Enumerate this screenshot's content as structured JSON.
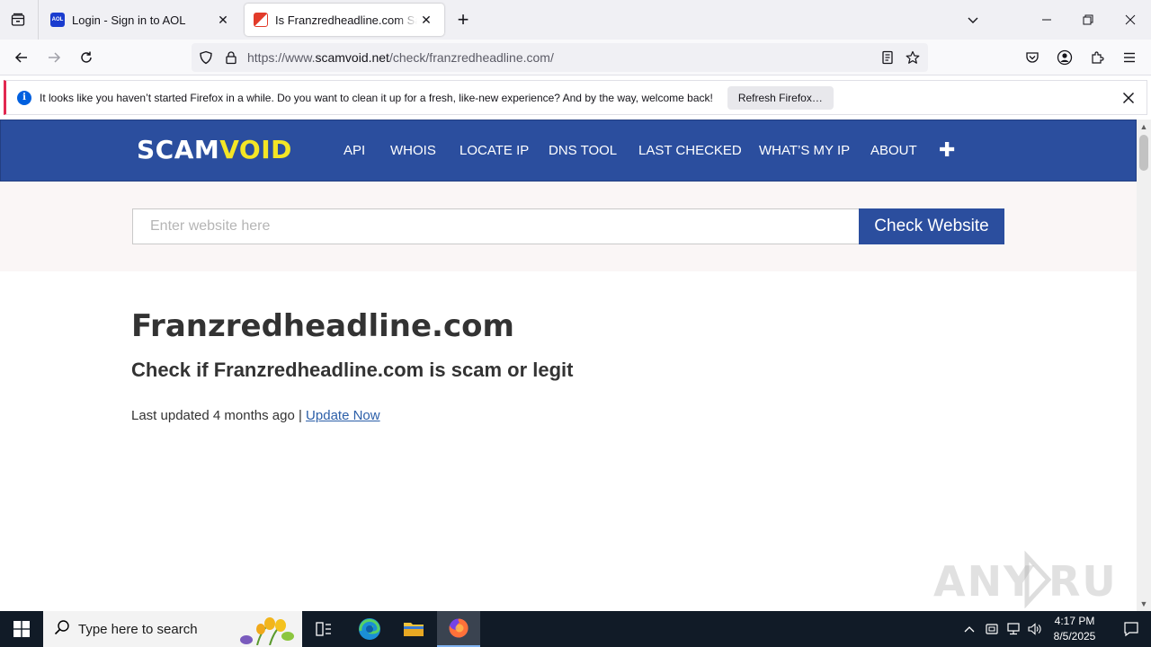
{
  "browser": {
    "tabs": [
      {
        "title": "Login - Sign in to AOL",
        "favicon": "aol-icon",
        "active": false
      },
      {
        "title": "Is Franzredheadline.com Safe or a Scam?",
        "favicon": "scamvoid-icon",
        "active": true
      }
    ],
    "url": {
      "prefix": "https://www.",
      "host": "scamvoid.net",
      "path": "/check/franzredheadline.com/"
    },
    "notification": {
      "message": "It looks like you haven’t started Firefox in a while. Do you want to clean it up for a fresh, like-new experience? And by the way, welcome back!",
      "button": "Refresh Firefox…"
    }
  },
  "site": {
    "logo": {
      "part1": "SCAM",
      "part2": "VOID"
    },
    "menu": [
      "API",
      "WHOIS",
      "LOCATE IP",
      "DNS TOOL",
      "LAST CHECKED",
      "WHAT’S MY IP",
      "ABOUT"
    ],
    "menu_more": "✚",
    "search": {
      "placeholder": "Enter website here",
      "button": "Check Website"
    },
    "domain_title": "Franzredheadline.com",
    "subtitle": "Check if Franzredheadline.com is scam or legit",
    "last_updated_prefix": "Last updated 4 months ago | ",
    "update_link": "Update Now"
  },
  "watermark": "ANY RUN",
  "taskbar": {
    "search_placeholder": "Type here to search",
    "time": "4:17 PM",
    "date": "8/5/2025"
  },
  "colors": {
    "site_blue": "#2b4e9e",
    "logo_yellow": "#f4e625",
    "notification_accent": "#e22850"
  }
}
